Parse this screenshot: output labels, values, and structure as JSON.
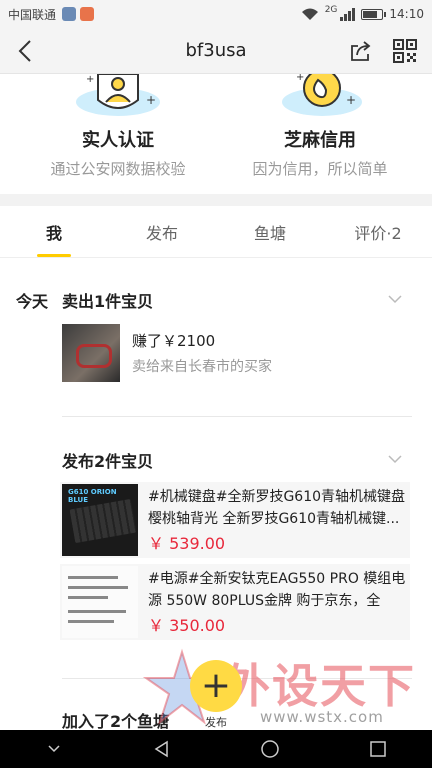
{
  "status_bar": {
    "carrier": "中国联通",
    "network": "2G",
    "time": "14:10",
    "battery_level": 0.85
  },
  "header": {
    "title": "bf3usa"
  },
  "verification": {
    "real_name": {
      "title": "实人认证",
      "desc": "通过公安网数据校验"
    },
    "sesame": {
      "title": "芝麻信用",
      "desc": "因为信用，所以简单"
    }
  },
  "tabs": [
    {
      "label": "我"
    },
    {
      "label": "发布"
    },
    {
      "label": "鱼塘"
    },
    {
      "label": "评价·2"
    }
  ],
  "timeline": {
    "day": "今天",
    "sold": {
      "title": "卖出1件宝贝",
      "earned": "赚了￥2100",
      "buyer": "卖给来自长春市的买家"
    },
    "published": {
      "title": "发布2件宝贝",
      "items": [
        {
          "text": "#机械键盘#全新罗技G610青轴机械键盘樱桃轴背光 全新罗技G610青轴机械键...",
          "price": "￥ 539.00",
          "thumb_caption": "G610 ORION BLUE"
        },
        {
          "text": "#电源#全新安钛克EAG550 PRO 模组电源 550W 80PLUS金牌 购于京东，全新...",
          "price": "￥ 350.00"
        }
      ]
    },
    "fishpond": {
      "title": "加入了2个鱼塘"
    }
  },
  "publish_button": {
    "label": "发布"
  },
  "watermark": {
    "text": "外设天下",
    "url": "www.wstx.com"
  }
}
